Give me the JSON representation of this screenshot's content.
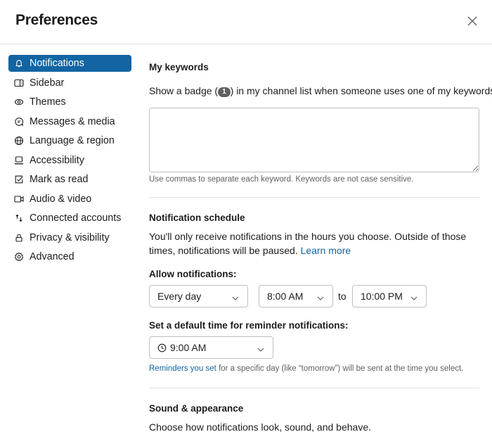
{
  "header": {
    "title": "Preferences",
    "close_icon": "close-icon"
  },
  "sidebar": {
    "items": [
      {
        "label": "Notifications",
        "icon": "bell-icon",
        "active": true
      },
      {
        "label": "Sidebar",
        "icon": "sidebar-icon",
        "active": false
      },
      {
        "label": "Themes",
        "icon": "eye-icon",
        "active": false
      },
      {
        "label": "Messages & media",
        "icon": "message-icon",
        "active": false
      },
      {
        "label": "Language & region",
        "icon": "globe-icon",
        "active": false
      },
      {
        "label": "Accessibility",
        "icon": "laptop-icon",
        "active": false
      },
      {
        "label": "Mark as read",
        "icon": "checkbox-icon",
        "active": false
      },
      {
        "label": "Audio & video",
        "icon": "video-icon",
        "active": false
      },
      {
        "label": "Connected accounts",
        "icon": "arrows-icon",
        "active": false
      },
      {
        "label": "Privacy & visibility",
        "icon": "lock-icon",
        "active": false
      },
      {
        "label": "Advanced",
        "icon": "gear-icon",
        "active": false
      }
    ]
  },
  "keywords": {
    "heading": "My keywords",
    "desc_before": "Show a badge (",
    "badge": "1",
    "desc_after": ") in my channel list when someone uses one of my keywords:",
    "value": "",
    "placeholder": "",
    "hint": "Use commas to separate each keyword. Keywords are not case sensitive."
  },
  "schedule": {
    "heading": "Notification schedule",
    "desc": "You'll only receive notifications in the hours you choose. Outside of those times, notifications will be paused. ",
    "learn_more": "Learn more",
    "allow_label": "Allow notifications:",
    "days_value": "Every day",
    "from_value": "8:00 AM",
    "to_label": "to",
    "to_value": "10:00 PM",
    "reminder_label": "Set a default time for reminder notifications:",
    "reminder_value": "9:00 AM",
    "reminder_link": "Reminders you set",
    "reminder_hint": " for a specific day (like “tomorrow”) will be sent at the time you select."
  },
  "sound": {
    "heading": "Sound & appearance",
    "desc": "Choose how notifications look, sound, and behave."
  },
  "colors": {
    "accent": "#1264a3",
    "text": "#1d1c1d",
    "muted": "#616061",
    "border": "#bfbfbf"
  }
}
